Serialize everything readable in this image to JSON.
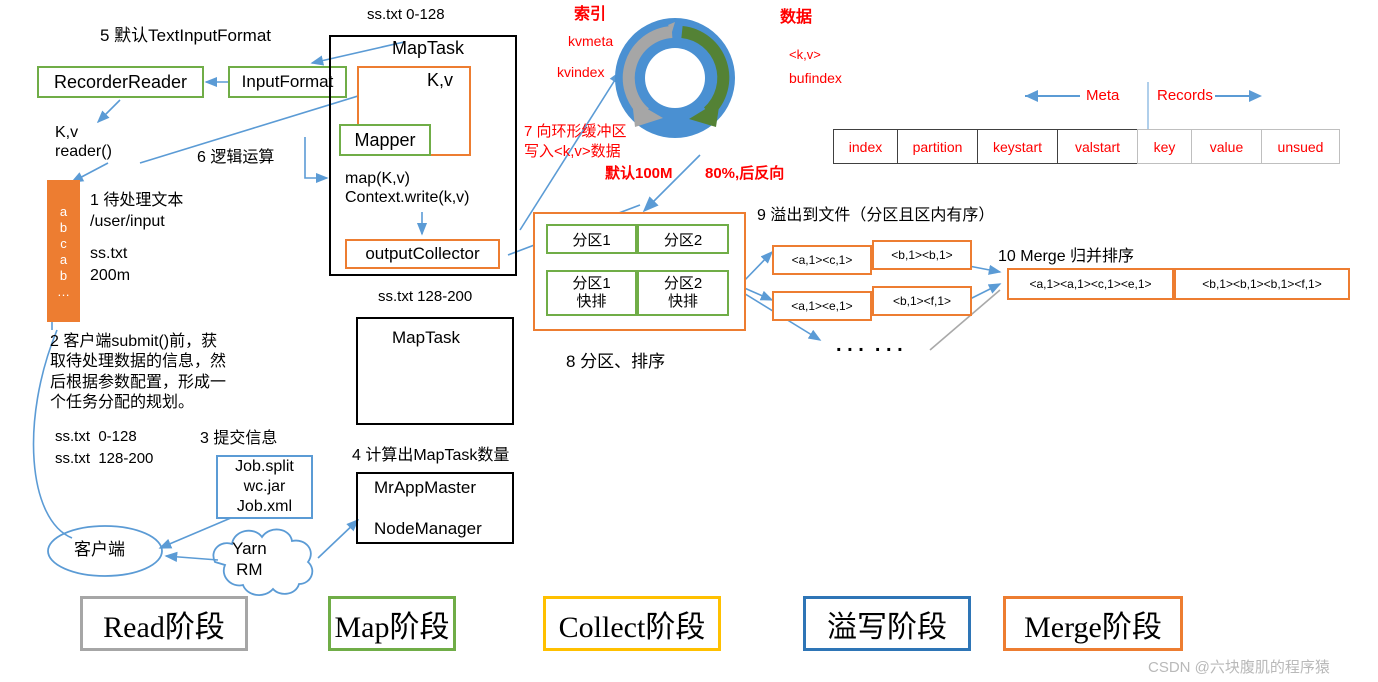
{
  "diagram": {
    "title": "MapReduce MapTask Shuffle Flow",
    "watermark": "CSDN @六块腹肌的程序猿"
  },
  "labels": {
    "step5": "5 默认TextInputFormat",
    "step1": "1 待处理文本",
    "step1_path": "/user/input",
    "step1_file": "ss.txt",
    "step1_size": "200m",
    "step2": "2 客户端submit()前，获\n取待处理数据的信息，然\n后根据参数配置，形成一\n个任务分配的规划。",
    "step2_split1": "ss.txt  0-128",
    "step2_split2": "ss.txt  128-200",
    "step3": "3 提交信息",
    "step4": "4 计算出MapTask数量",
    "step6": "6 逻辑运算",
    "step7": "7 向环形缓冲区\n写入<k,v>数据",
    "step8": "8 分区、排序",
    "step9": "9 溢出到文件（分区且区内有序）",
    "step10": "10 Merge 归并排序",
    "kv_reader": "K,v\nreader()",
    "map_lines": "map(K,v)\nContext.write(k,v)",
    "split_top": "ss.txt 0-128",
    "split_bottom": "ss.txt 128-200",
    "ellipsis": ". . .  . . ."
  },
  "boxes": {
    "recorder_reader": "RecorderReader",
    "input_format": "InputFormat",
    "map_task_top": "MapTask",
    "map_task_bottom": "MapTask",
    "kv": "K,v",
    "mapper": "Mapper",
    "output_collector": "outputCollector",
    "job_split": "Job.split\nwc.jar\nJob.xml",
    "mr_app_master": "MrAppMaster",
    "node_manager": "NodeManager",
    "client": "客户端",
    "yarn_rm": "Yarn\nRM"
  },
  "text_block": {
    "lines": [
      "a",
      "b",
      "c",
      "a",
      "b",
      "…"
    ]
  },
  "buffer": {
    "index_title": "索引",
    "kvmeta": "kvmeta",
    "kvindex": "kvindex",
    "data_title": "数据",
    "kv_pair": "<k,v>",
    "bufindex": "bufindex",
    "capacity": "默认100M",
    "threshold": "80%,后反向",
    "colors": {
      "ring": "#4A90D2",
      "meta_arrow": "#A6A6A6",
      "data_arrow": "#548235"
    }
  },
  "partition_panel": {
    "row1": [
      "分区1",
      "分区2"
    ],
    "row2": [
      "分区1\n快排",
      "分区2\n快排"
    ]
  },
  "spill_files": [
    [
      "<a,1><c,1>",
      "<b,1><b,1>"
    ],
    [
      "<a,1><e,1>",
      "<b,1><f,1>"
    ]
  ],
  "merge_file": [
    "<a,1><a,1><c,1><e,1>",
    "<b,1><b,1><b,1><f,1>"
  ],
  "meta_table": {
    "meta_label": "Meta",
    "records_label": "Records",
    "meta_cells": [
      "index",
      "partition",
      "keystart",
      "valstart"
    ],
    "record_cells": [
      "key",
      "value",
      "unsued"
    ]
  },
  "stages": [
    {
      "label": "Read阶段",
      "color": "#A6A6A6"
    },
    {
      "label": "Map阶段",
      "color": "#70AD47"
    },
    {
      "label": "Collect阶段",
      "color": "#FFC000"
    },
    {
      "label": "溢写阶段",
      "color": "#2E75B6"
    },
    {
      "label": "Merge阶段",
      "color": "#ED7D31"
    }
  ]
}
